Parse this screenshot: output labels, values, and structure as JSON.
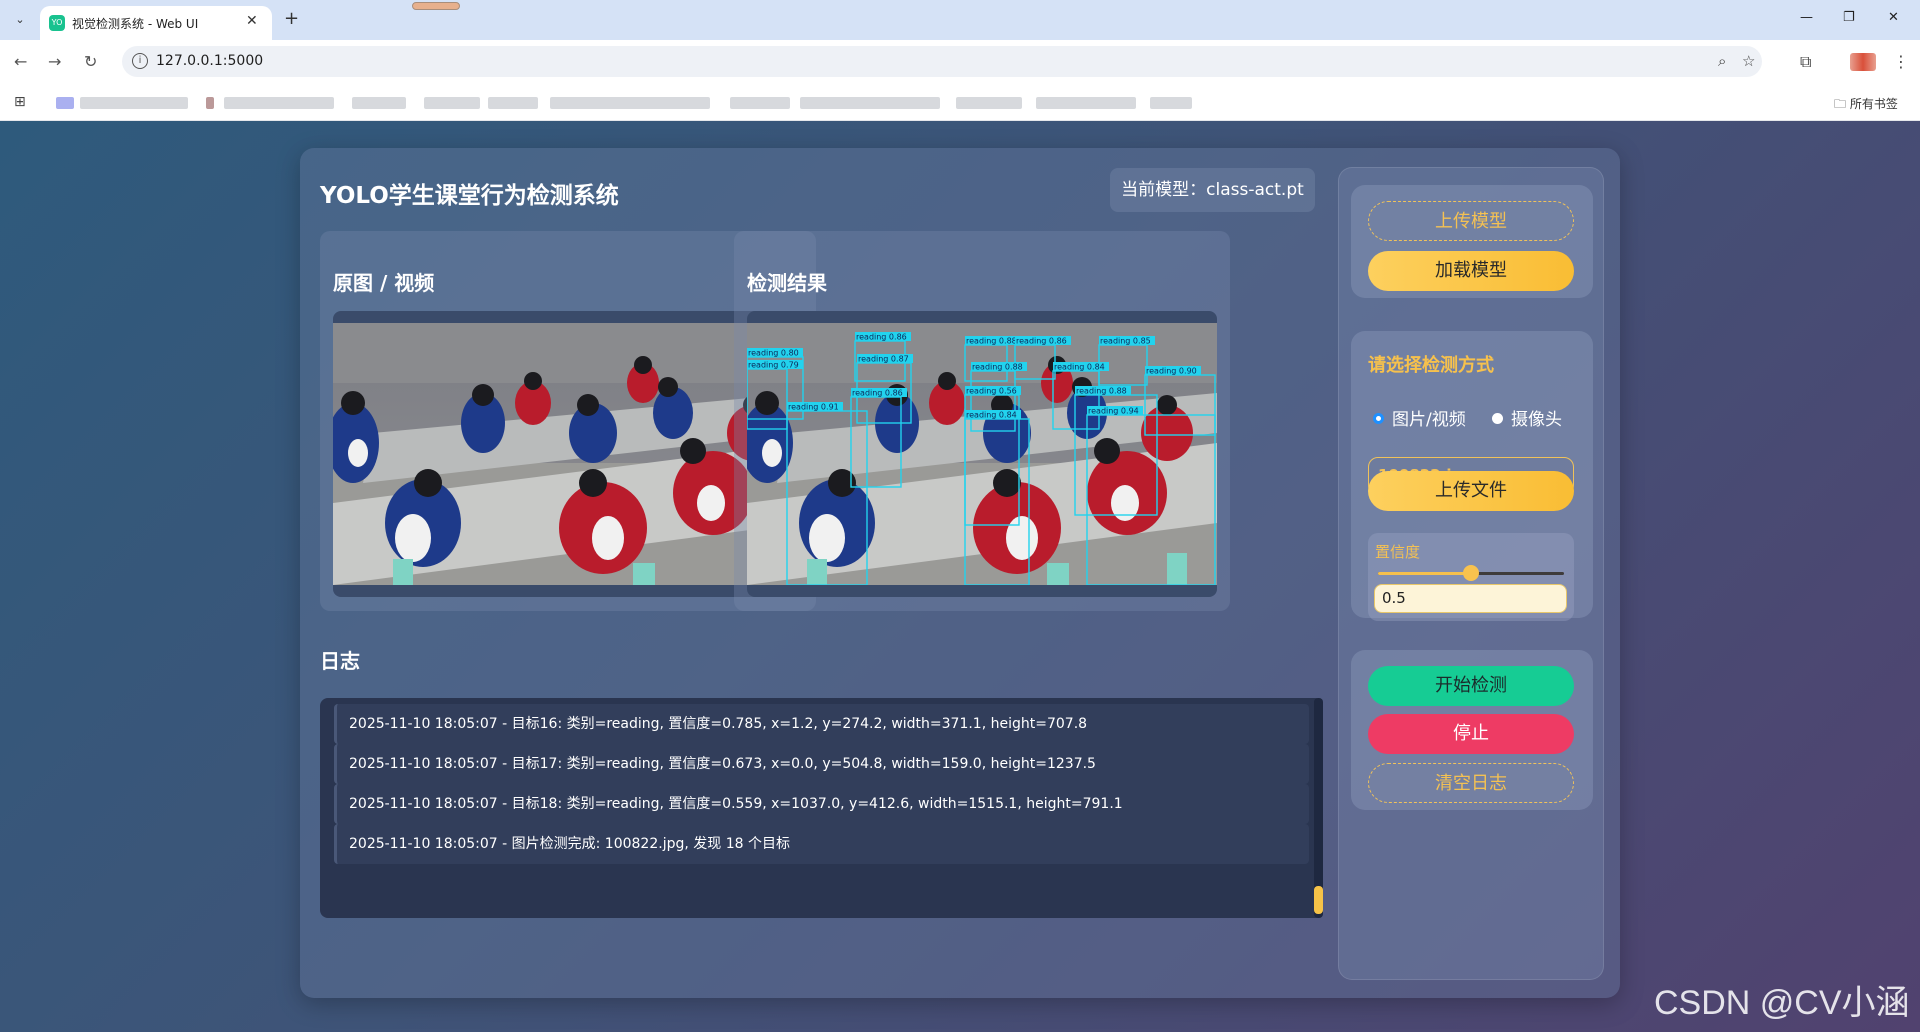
{
  "browser": {
    "tab_title": "视觉检测系统 - Web UI",
    "tab_favicon_text": "YO",
    "url": "127.0.0.1:5000",
    "bookmarks_all_label": "所有书签"
  },
  "app": {
    "title": "YOLO学生课堂行为检测系统",
    "model_badge": "当前模型：class-act.pt"
  },
  "panels": {
    "original_title": "原图 / 视频",
    "result_title": "检测结果"
  },
  "detections": [
    {
      "label": "reading 0.86"
    },
    {
      "label": "reading 0.88"
    },
    {
      "label": "reading 0.86"
    },
    {
      "label": "reading 0.85"
    },
    {
      "label": "reading 0.80"
    },
    {
      "label": "reading 0.79"
    },
    {
      "label": "reading 0.87"
    },
    {
      "label": "reading 0.88"
    },
    {
      "label": "reading 0.84"
    },
    {
      "label": "reading 0.90"
    },
    {
      "label": "reading 0.86"
    },
    {
      "label": "reading 0.56"
    },
    {
      "label": "reading 0.88"
    },
    {
      "label": "reading 0.91"
    },
    {
      "label": "reading 0.94"
    },
    {
      "label": "reading 0.84"
    }
  ],
  "log": {
    "title": "日志",
    "entries": [
      "2025-11-10 18:05:07 - 目标16: 类别=reading, 置信度=0.785, x=1.2, y=274.2, width=371.1, height=707.8",
      "2025-11-10 18:05:07 - 目标17: 类别=reading, 置信度=0.673, x=0.0, y=504.8, width=159.0, height=1237.5",
      "2025-11-10 18:05:07 - 目标18: 类别=reading, 置信度=0.559, x=1037.0, y=412.6, width=1515.1, height=791.1",
      "2025-11-10 18:05:07 - 图片检测完成: 100822.jpg, 发现 18 个目标"
    ]
  },
  "sidebar": {
    "upload_model": "上传模型",
    "load_model": "加载模型",
    "mode_title": "请选择检测方式",
    "mode_image": "图片/视频",
    "mode_camera": "摄像头",
    "selected_mode": "图片/视频",
    "file_name": "100822.jpg",
    "upload_file": "上传文件",
    "confidence_label": "置信度",
    "confidence_value": "0.5",
    "start": "开始检测",
    "stop": "停止",
    "clear_log": "清空日志"
  },
  "watermark": "CSDN @CV小涵",
  "colors": {
    "accent_yellow": "#f7c14c",
    "start_green": "#16cc94",
    "stop_red": "#ee3b64",
    "detection_box": "#22d3ee"
  }
}
